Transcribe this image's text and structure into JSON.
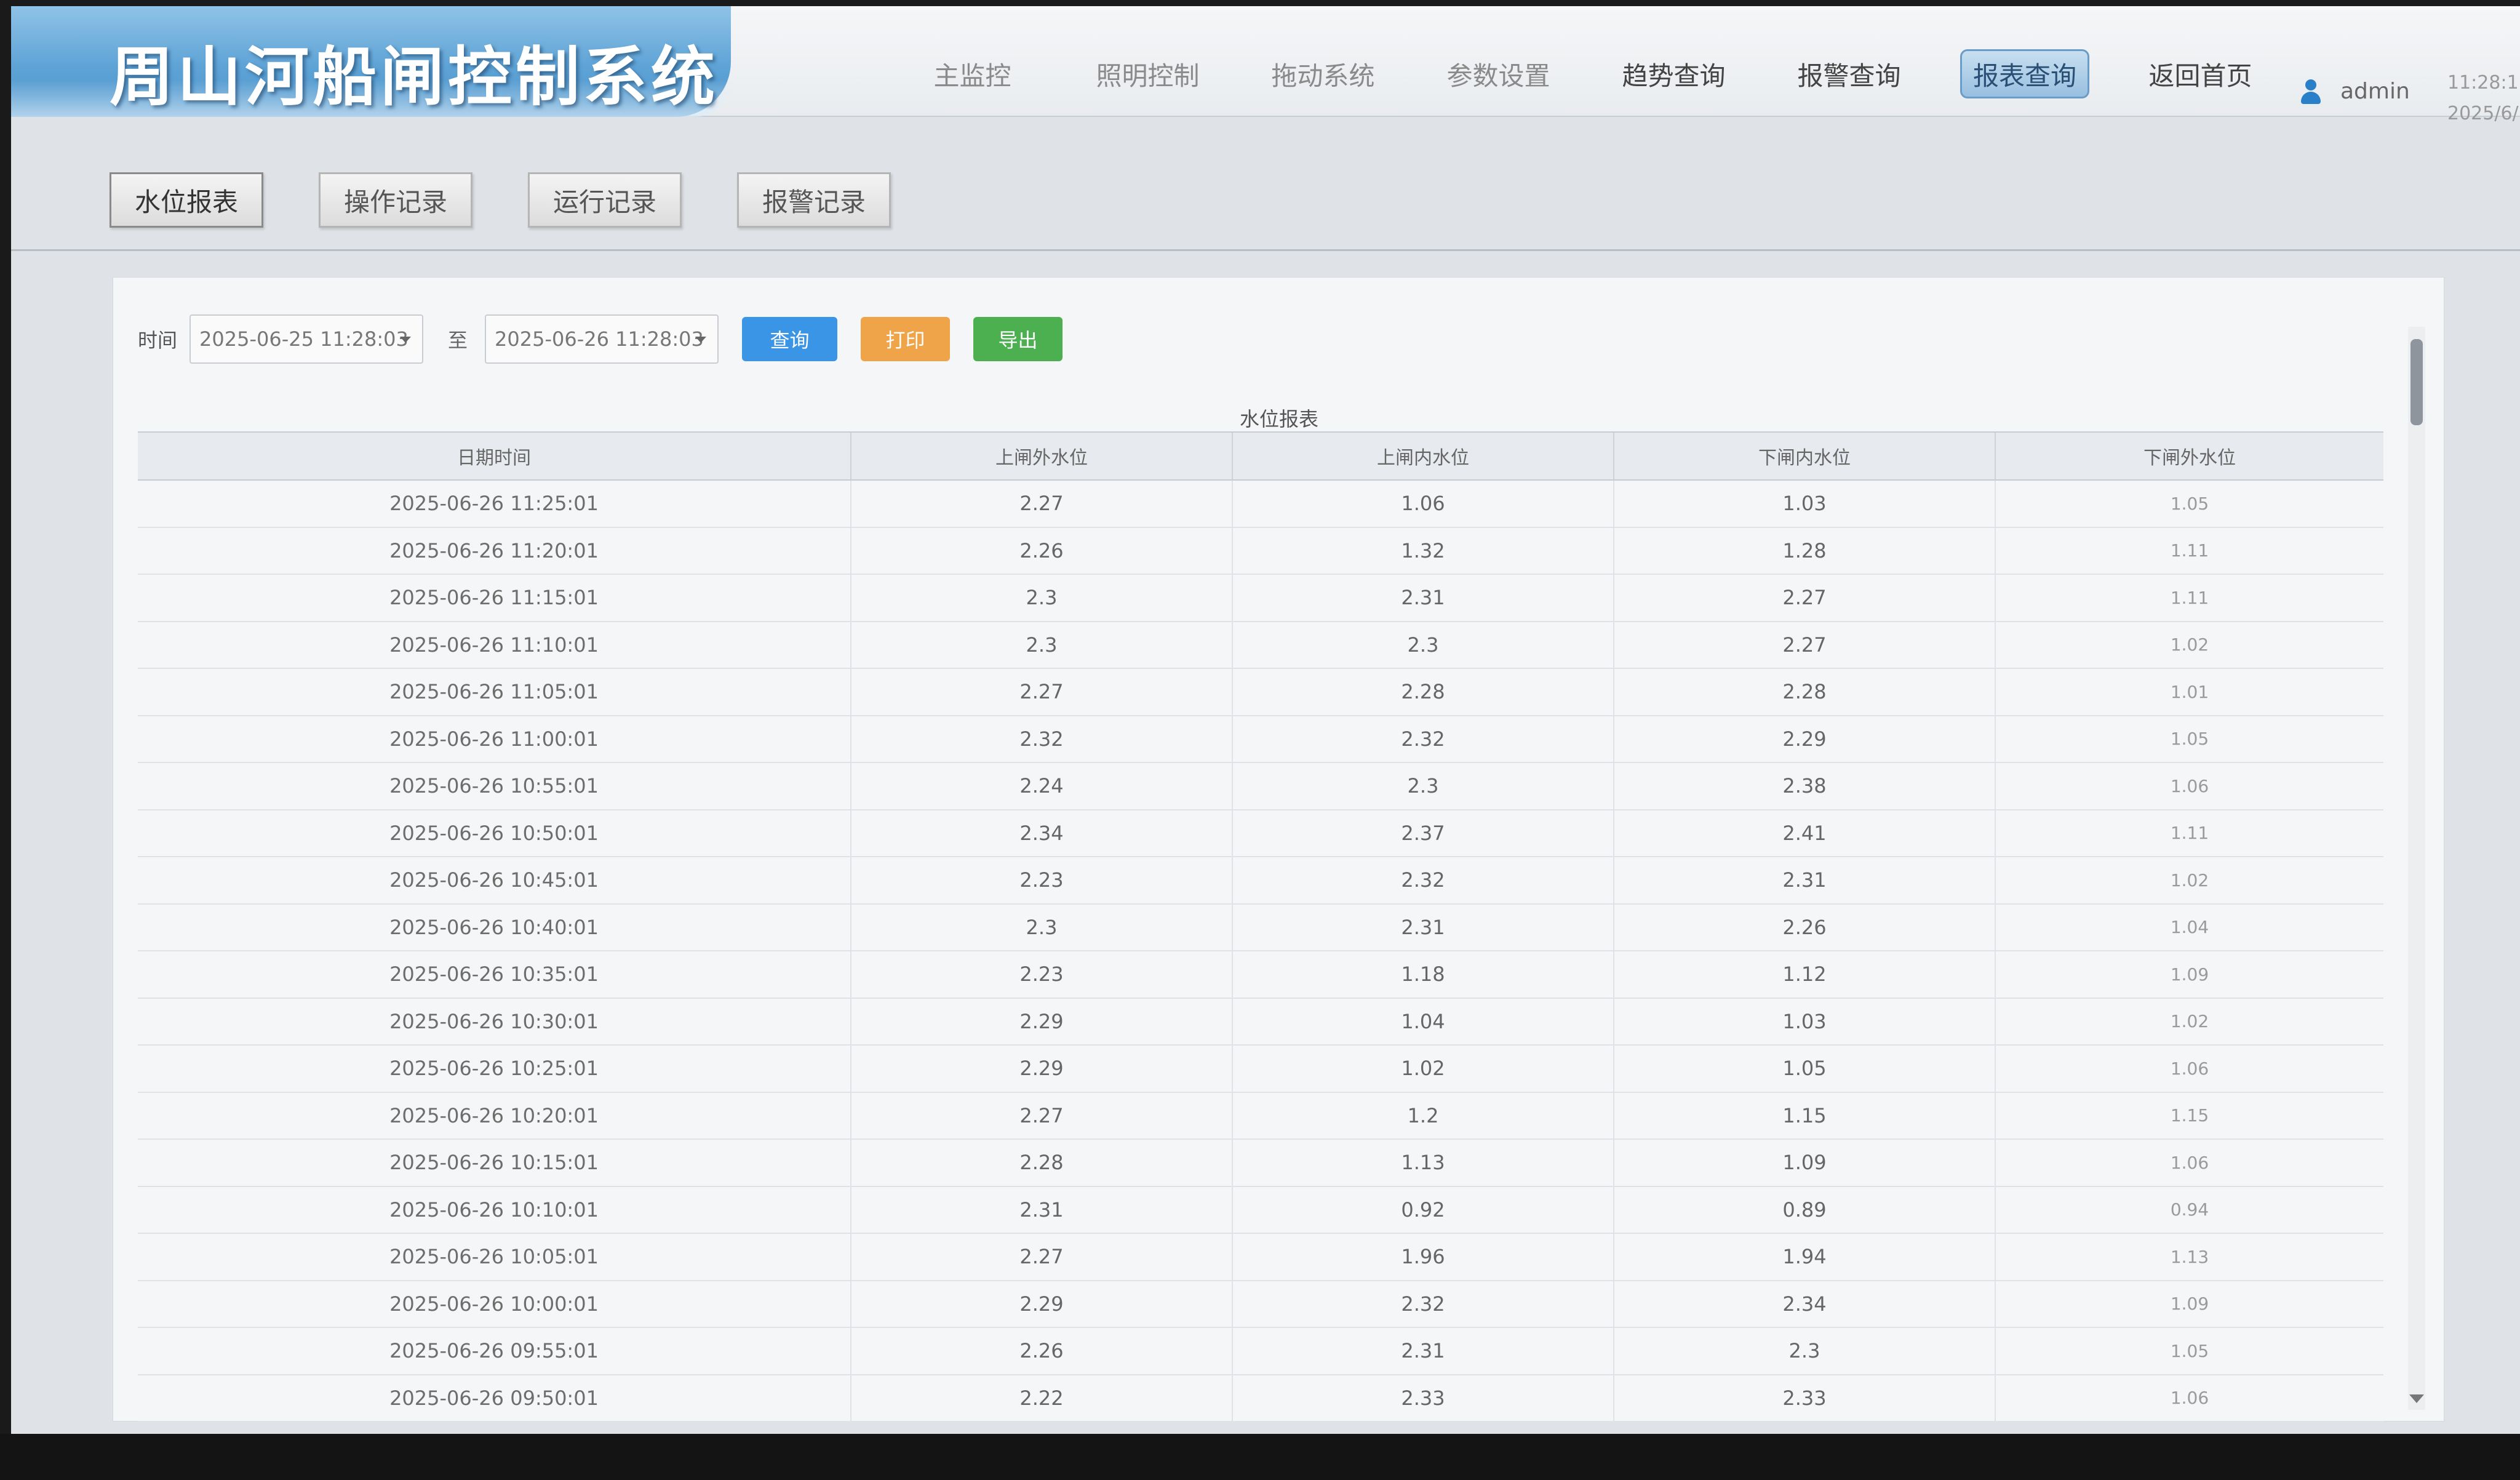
{
  "app": {
    "title": "周山河船闸控制系统"
  },
  "nav": [
    {
      "label": "主监控"
    },
    {
      "label": "照明控制"
    },
    {
      "label": "拖动系统"
    },
    {
      "label": "参数设置"
    },
    {
      "label": "趋势查询"
    },
    {
      "label": "报警查询"
    },
    {
      "label": "报表查询"
    },
    {
      "label": "返回首页"
    }
  ],
  "user": {
    "name": "admin"
  },
  "clock": {
    "time": "11:28:1",
    "date": "2025/6/"
  },
  "subtabs": [
    {
      "label": "水位报表"
    },
    {
      "label": "操作记录"
    },
    {
      "label": "运行记录"
    },
    {
      "label": "报警记录"
    }
  ],
  "filter": {
    "time_label": "时间",
    "start": "2025-06-25 11:28:03",
    "to_label": "至",
    "end": "2025-06-26 11:28:03",
    "query_label": "查询",
    "print_label": "打印",
    "export_label": "导出"
  },
  "table": {
    "title": "水位报表",
    "columns": [
      "日期时间",
      "上闸外水位",
      "上闸内水位",
      "下闸内水位",
      "下闸外水位"
    ],
    "rows": [
      [
        "2025-06-26 11:25:01",
        "2.27",
        "1.06",
        "1.03",
        "1.05"
      ],
      [
        "2025-06-26 11:20:01",
        "2.26",
        "1.32",
        "1.28",
        "1.11"
      ],
      [
        "2025-06-26 11:15:01",
        "2.3",
        "2.31",
        "2.27",
        "1.11"
      ],
      [
        "2025-06-26 11:10:01",
        "2.3",
        "2.3",
        "2.27",
        "1.02"
      ],
      [
        "2025-06-26 11:05:01",
        "2.27",
        "2.28",
        "2.28",
        "1.01"
      ],
      [
        "2025-06-26 11:00:01",
        "2.32",
        "2.32",
        "2.29",
        "1.05"
      ],
      [
        "2025-06-26 10:55:01",
        "2.24",
        "2.3",
        "2.38",
        "1.06"
      ],
      [
        "2025-06-26 10:50:01",
        "2.34",
        "2.37",
        "2.41",
        "1.11"
      ],
      [
        "2025-06-26 10:45:01",
        "2.23",
        "2.32",
        "2.31",
        "1.02"
      ],
      [
        "2025-06-26 10:40:01",
        "2.3",
        "2.31",
        "2.26",
        "1.04"
      ],
      [
        "2025-06-26 10:35:01",
        "2.23",
        "1.18",
        "1.12",
        "1.09"
      ],
      [
        "2025-06-26 10:30:01",
        "2.29",
        "1.04",
        "1.03",
        "1.02"
      ],
      [
        "2025-06-26 10:25:01",
        "2.29",
        "1.02",
        "1.05",
        "1.06"
      ],
      [
        "2025-06-26 10:20:01",
        "2.27",
        "1.2",
        "1.15",
        "1.15"
      ],
      [
        "2025-06-26 10:15:01",
        "2.28",
        "1.13",
        "1.09",
        "1.06"
      ],
      [
        "2025-06-26 10:10:01",
        "2.31",
        "0.92",
        "0.89",
        "0.94"
      ],
      [
        "2025-06-26 10:05:01",
        "2.27",
        "1.96",
        "1.94",
        "1.13"
      ],
      [
        "2025-06-26 10:00:01",
        "2.29",
        "2.32",
        "2.34",
        "1.09"
      ],
      [
        "2025-06-26 09:55:01",
        "2.26",
        "2.31",
        "2.3",
        "1.05"
      ],
      [
        "2025-06-26 09:50:01",
        "2.22",
        "2.33",
        "2.33",
        "1.06"
      ]
    ]
  }
}
